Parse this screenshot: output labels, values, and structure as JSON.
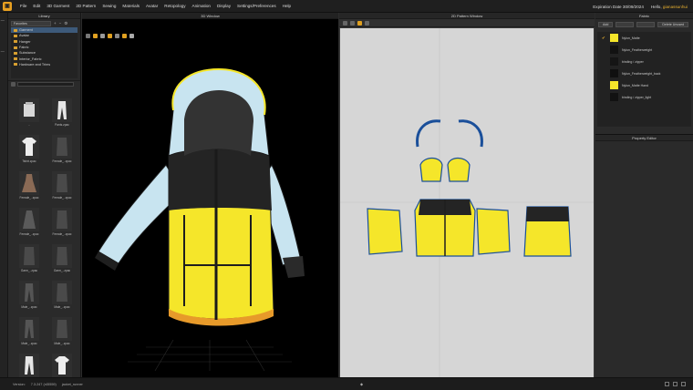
{
  "menubar": {
    "logo": "logo-icon",
    "items": [
      "File",
      "Edit",
      "3D Garment",
      "2D Pattern",
      "Sewing",
      "Materials",
      "Avatar",
      "Retopology",
      "Animation",
      "Display",
      "Settings/Preferences",
      "Help"
    ],
    "expiration": "Expiration Date 30/09/2024",
    "hello": "Hello,",
    "user": "gianassunhui"
  },
  "library": {
    "title": "Library",
    "dropdown": "Favorites",
    "favorites": [
      "Garment",
      "Avatar",
      "Hanger",
      "Fabric",
      "Substance",
      "Interior_Fabric",
      "Hardware and Trims"
    ],
    "thumbnails": [
      {
        "label": "..",
        "shape": "folder"
      },
      {
        "label": "Pants.zpac",
        "shape": "pants"
      },
      {
        "label": "Tshirt.zpac",
        "shape": "tshirt"
      },
      {
        "label": "Female_..zpac",
        "shape": "dark"
      },
      {
        "label": "Female_..zpac",
        "shape": "dress"
      },
      {
        "label": "Female_..zpac",
        "shape": "dark"
      },
      {
        "label": "Female_..zpac",
        "shape": "skirt"
      },
      {
        "label": "Female_..zpac",
        "shape": "dark"
      },
      {
        "label": "Garm_..zpac",
        "shape": "dark"
      },
      {
        "label": "Garm_..zpac",
        "shape": "dark"
      },
      {
        "label": "Male_..zpac",
        "shape": "pants-dark"
      },
      {
        "label": "Male_..zpac",
        "shape": "dark"
      },
      {
        "label": "Male_..zpac",
        "shape": "pants-dark"
      },
      {
        "label": "Male_..zpac",
        "shape": "dark"
      },
      {
        "label": "Pants.zpac",
        "shape": "pants"
      },
      {
        "label": "Tshirt.zpac",
        "shape": "tshirt"
      }
    ]
  },
  "win3d": {
    "title": "3D Window"
  },
  "win2d": {
    "title": "2D Pattern Window"
  },
  "fabric": {
    "title": "Fabric",
    "buttons": [
      "Add",
      "",
      "",
      "Delete Unused"
    ],
    "items": [
      {
        "name": "Nylon_Matte",
        "color": "#f5e62a",
        "selected": true
      },
      {
        "name": "Nylon_Featherweight",
        "color": "#121212",
        "selected": false
      },
      {
        "name": "binding / zipper",
        "color": "#151515",
        "selected": false
      },
      {
        "name": "Nylon_Featherweight_back",
        "color": "#101010",
        "selected": false
      },
      {
        "name": "Nylon_Matte Hand",
        "color": "#f5e62a",
        "selected": false
      },
      {
        "name": "binding / zipper_light",
        "color": "#121212",
        "selected": false
      }
    ]
  },
  "property_editor": {
    "title": "Property Editor"
  },
  "status": {
    "version_label": "Version:",
    "version": "7.3.247 (r45559)",
    "file": "jacket_runner",
    "mid": "◆"
  },
  "colors": {
    "yellow": "#f5e62a",
    "ice_blue": "#c8e4f0",
    "charcoal": "#2a2a2a",
    "pattern_outline": "#1a4f9a"
  }
}
